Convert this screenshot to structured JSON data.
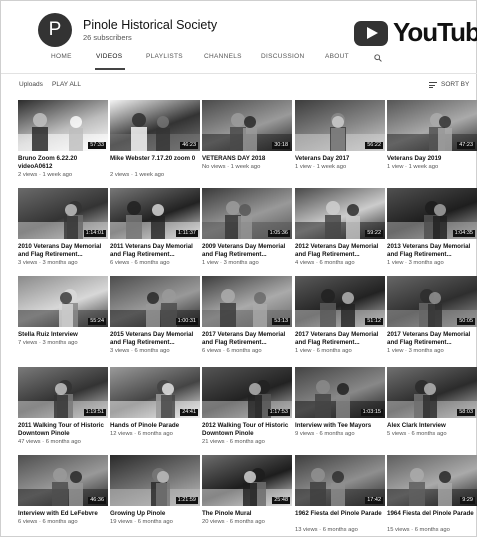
{
  "channel": {
    "avatar_letter": "P",
    "name": "Pinole Historical Society",
    "subscribers": "26 subscribers",
    "logo_text": "YouTube"
  },
  "tabs": [
    {
      "label": "HOME",
      "active": false
    },
    {
      "label": "VIDEOS",
      "active": true
    },
    {
      "label": "PLAYLISTS",
      "active": false
    },
    {
      "label": "CHANNELS",
      "active": false
    },
    {
      "label": "DISCUSSION",
      "active": false
    },
    {
      "label": "ABOUT",
      "active": false
    }
  ],
  "uploads": {
    "label": "Uploads",
    "play_all": "PLAY ALL",
    "sort_by": "SORT BY"
  },
  "videos": [
    {
      "title": "Bruno Zoom 6.22.20 videoA0612",
      "meta": "2 views · 1 week ago",
      "duration": "57:33"
    },
    {
      "title": "Mike Webster 7.17.20 zoom 0",
      "meta": "2 views · 1 week ago",
      "duration": "46:23"
    },
    {
      "title": "VETERANS DAY 2018",
      "meta": "No views · 1 week ago",
      "duration": "30:18"
    },
    {
      "title": "Veterans Day 2017",
      "meta": "1 view · 1 week ago",
      "duration": "56:22"
    },
    {
      "title": "Veterans Day 2019",
      "meta": "1 view · 1 week ago",
      "duration": "47:23"
    },
    {
      "title": "2010 Veterans Day Memorial and Flag Retirement...",
      "meta": "3 views · 3 months ago",
      "duration": "1:14:01"
    },
    {
      "title": "2011 Veterans Day Memorial and Flag Retirement...",
      "meta": "6 views · 6 months ago",
      "duration": "1:11:37"
    },
    {
      "title": "2009 Veterans Day Memorial and Flag Retirement...",
      "meta": "1 view · 3 months ago",
      "duration": "1:05:36"
    },
    {
      "title": "2012 Veterans Day Memorial and Flag Retirement...",
      "meta": "4 views · 6 months ago",
      "duration": "59:22"
    },
    {
      "title": "2013 Veterans Day Memorial and Flag Retirement...",
      "meta": "1 view · 3 months ago",
      "duration": "1:04:35"
    },
    {
      "title": "Stella Ruiz Interview",
      "meta": "7 views · 3 months ago",
      "duration": "55:24"
    },
    {
      "title": "2015 Veterans Day Memorial and Flag Retirement...",
      "meta": "3 views · 6 months ago",
      "duration": "1:00:31"
    },
    {
      "title": "2017 Veterans Day Memorial and Flag Retirement...",
      "meta": "6 views · 6 months ago",
      "duration": "53:13"
    },
    {
      "title": "2017 Veterans Day Memorial and Flag Retirement...",
      "meta": "1 view · 6 months ago",
      "duration": "51:12"
    },
    {
      "title": "2017 Veterans Day Memorial and Flag Retirement...",
      "meta": "1 view · 3 months ago",
      "duration": "50:05"
    },
    {
      "title": "2011 Walking Tour of Historic Downtown Pinole",
      "meta": "47 views · 6 months ago",
      "duration": "1:19:51"
    },
    {
      "title": "Hands of Pinole Parade",
      "meta": "12 views · 6 months ago",
      "duration": "24:41"
    },
    {
      "title": "2012 Walking Tour of Historic Downtown Pinole",
      "meta": "21 views · 6 months ago",
      "duration": "1:17:53"
    },
    {
      "title": "Interview with Tee Mayors",
      "meta": "9 views · 6 months ago",
      "duration": "1:03:15"
    },
    {
      "title": "Alex Clark Interview",
      "meta": "5 views · 6 months ago",
      "duration": "58:03"
    },
    {
      "title": "Interview with Ed LeFebvre",
      "meta": "6 views · 6 months ago",
      "duration": "46:36"
    },
    {
      "title": "Growing Up Pinole",
      "meta": "19 views · 6 months ago",
      "duration": "1:21:59"
    },
    {
      "title": "The Pinole Mural",
      "meta": "20 views · 6 months ago",
      "duration": "25:48"
    },
    {
      "title": "1962 Fiesta del Pinole Parade",
      "meta": "13 views · 6 months ago",
      "duration": "17:42"
    },
    {
      "title": "1964 Fiesta del Pinole Parade",
      "meta": "15 views · 6 months ago",
      "duration": "9:29"
    }
  ],
  "icons": {
    "search": "search-icon",
    "sort": "sort-icon",
    "logo": "youtube-logo-icon"
  }
}
